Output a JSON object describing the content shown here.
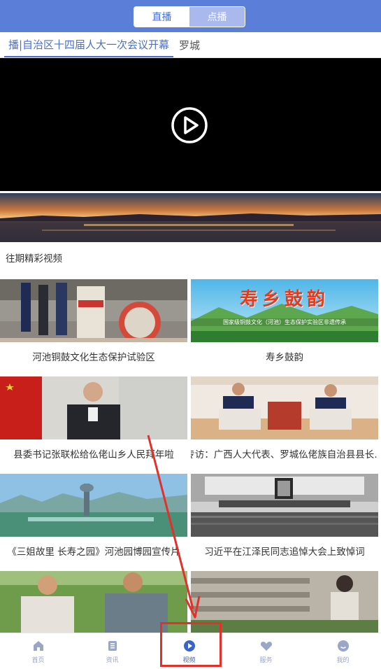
{
  "header": {
    "segments": {
      "live": "直播",
      "vod": "点播"
    }
  },
  "tabs": {
    "active": "播|自治区十四届人大一次会议开幕",
    "other": "罗城"
  },
  "player": {
    "icon": "play-icon"
  },
  "section": {
    "title": "往期精彩视频"
  },
  "videos": [
    {
      "caption": "河池铜鼓文化生态保护试验区"
    },
    {
      "caption": "寿乡鼓韵",
      "overlay_title": "寿乡鼓韵",
      "overlay_sub": "国家级铜鼓文化（河池）生态保护实验区非遗传承"
    },
    {
      "caption": "县委书记张联松给仫佬山乡人民拜年啦"
    },
    {
      "caption": "专访：广西人大代表、罗城仫佬族自治县县长…"
    },
    {
      "caption": "《三姐故里 长寿之园》河池园博园宣传片"
    },
    {
      "caption": "习近平在江泽民同志追悼大会上致悼词"
    },
    {
      "caption": ""
    },
    {
      "caption": ""
    }
  ],
  "nav": {
    "items": [
      {
        "label": "首页",
        "icon": "home-icon"
      },
      {
        "label": "资讯",
        "icon": "news-icon"
      },
      {
        "label": "视频",
        "icon": "video-icon"
      },
      {
        "label": "服务",
        "icon": "heart-icon"
      },
      {
        "label": "我的",
        "icon": "profile-icon"
      }
    ]
  },
  "colors": {
    "brand": "#5b7fd8",
    "active": "#3a64c8",
    "annotation": "#e0322a"
  }
}
